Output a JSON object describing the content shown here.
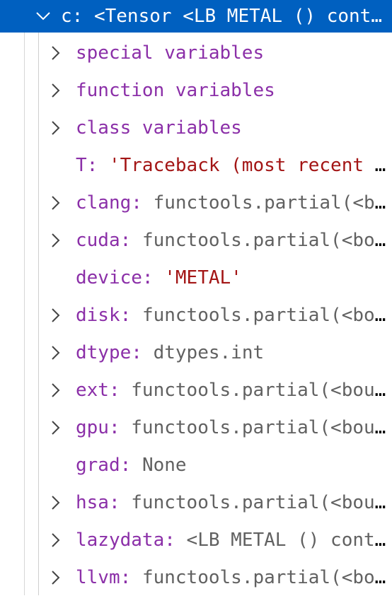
{
  "header": {
    "name": "c",
    "value": "<Tensor <LB METAL () conti..."
  },
  "rows": [
    {
      "name": "special variables",
      "value": "",
      "expandable": true,
      "kind": "group"
    },
    {
      "name": "function variables",
      "value": "",
      "expandable": true,
      "kind": "group"
    },
    {
      "name": "class variables",
      "value": "",
      "expandable": true,
      "kind": "group"
    },
    {
      "name": "T",
      "value": "'Traceback (most recent c...",
      "expandable": false,
      "kind": "string"
    },
    {
      "name": "clang",
      "value": "functools.partial(<bo...",
      "expandable": true,
      "kind": "object"
    },
    {
      "name": "cuda",
      "value": "functools.partial(<bou...",
      "expandable": true,
      "kind": "object"
    },
    {
      "name": "device",
      "value": "'METAL'",
      "expandable": false,
      "kind": "string"
    },
    {
      "name": "disk",
      "value": "functools.partial(<bou...",
      "expandable": true,
      "kind": "object"
    },
    {
      "name": "dtype",
      "value": "dtypes.int",
      "expandable": true,
      "kind": "object"
    },
    {
      "name": "ext",
      "value": "functools.partial(<boun...",
      "expandable": true,
      "kind": "object"
    },
    {
      "name": "gpu",
      "value": "functools.partial(<boun...",
      "expandable": true,
      "kind": "object"
    },
    {
      "name": "grad",
      "value": "None",
      "expandable": false,
      "kind": "object"
    },
    {
      "name": "hsa",
      "value": "functools.partial(<boun...",
      "expandable": true,
      "kind": "object"
    },
    {
      "name": "lazydata",
      "value": "<LB METAL () conti...",
      "expandable": true,
      "kind": "object"
    },
    {
      "name": "llvm",
      "value": "functools.partial(<bou...",
      "expandable": true,
      "kind": "object"
    }
  ],
  "colors": {
    "selection": "#0060c0",
    "name": "#8b2fa8",
    "value": "#616161",
    "string": "#a31515"
  },
  "icons": {
    "expanded": "chevron-down-icon",
    "collapsed": "chevron-right-icon"
  }
}
